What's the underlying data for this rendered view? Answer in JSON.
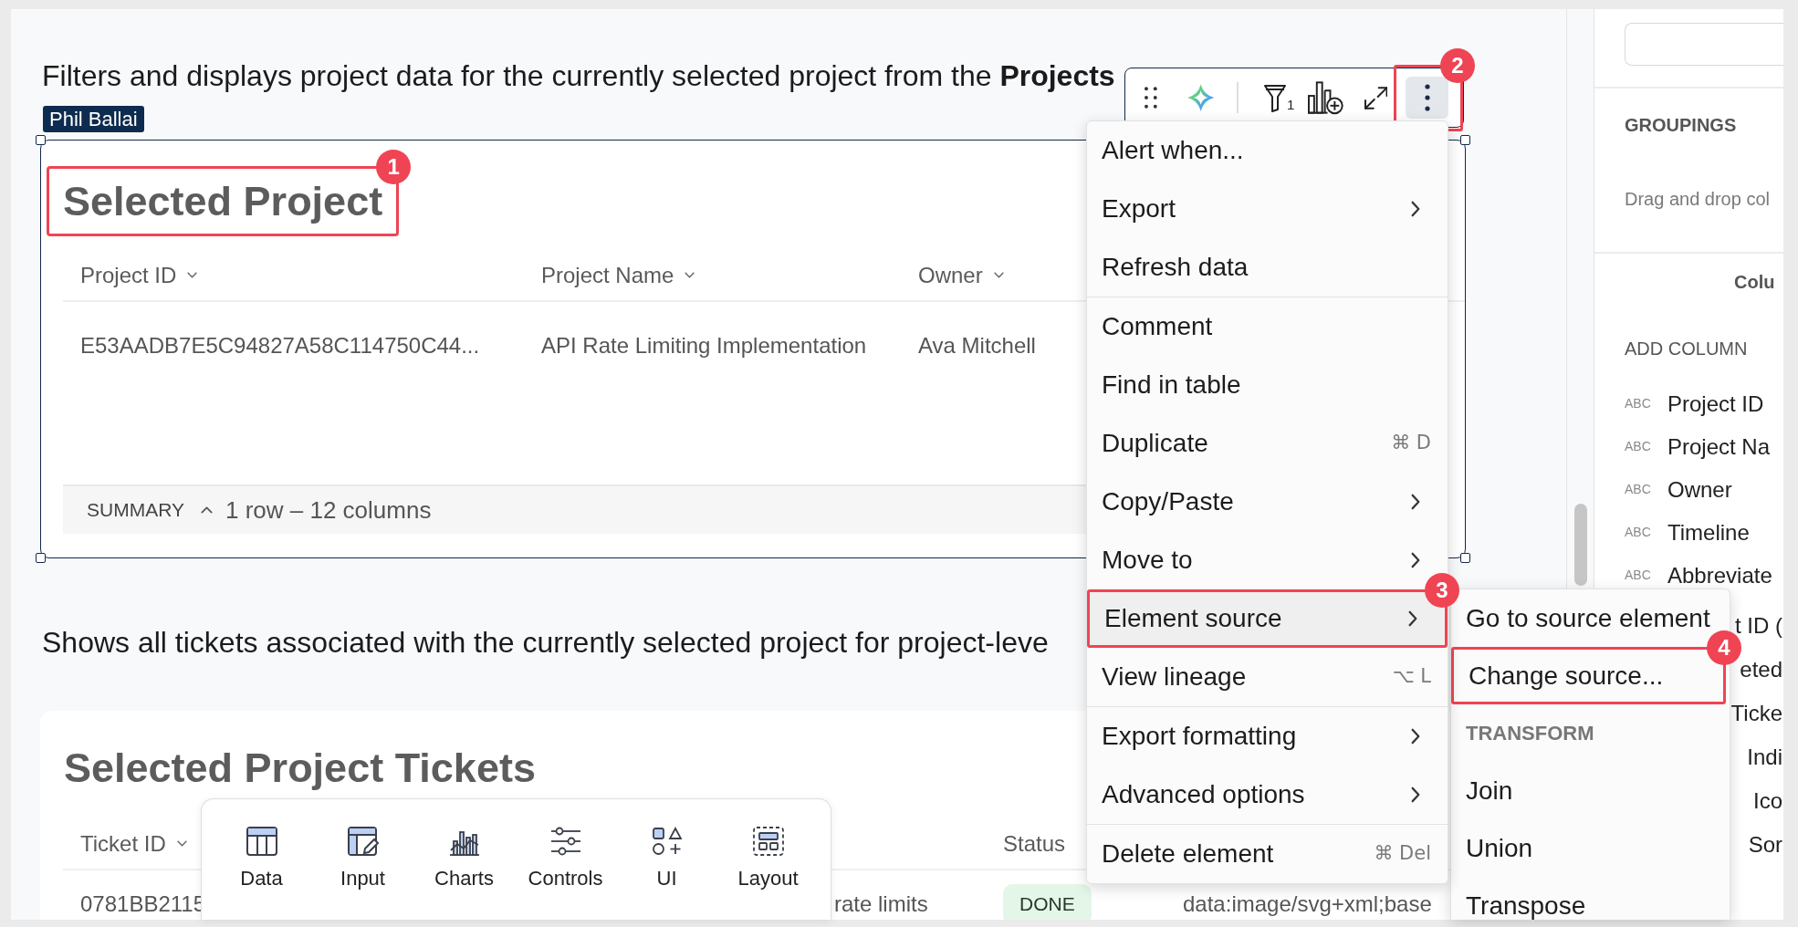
{
  "description_top": "Filters and displays project data for the currently selected project from the **Projects**",
  "selected_project": {
    "user_tag": "Phil Ballai",
    "title": "Selected Project",
    "callout": "1",
    "columns": [
      "Project ID",
      "Project Name",
      "Owner"
    ],
    "rows": [
      [
        "E53AADB7E5C94827A58C114750C44...",
        "API Rate Limiting Implementation",
        "Ava Mitchell"
      ]
    ],
    "summary": {
      "label": "SUMMARY",
      "count": "1 row – 12 columns"
    }
  },
  "description_bottom": "Shows all tickets associated with the currently selected project for project-leve",
  "tickets": {
    "title": "Selected Project Tickets",
    "header": {
      "ticket_id": "Ticket ID",
      "status": "Status"
    },
    "rows": [
      {
        "ticket_id": "0781BB2115",
        "column_2": "rate limits",
        "status": "DONE",
        "column_4": "data:image/svg+xml;base"
      }
    ]
  },
  "element_toolbar": {
    "filter_count": "1",
    "more_button": {
      "selected": true,
      "callout": "2"
    }
  },
  "context_menu": {
    "groups": [
      [
        {
          "label": "Alert when...",
          "submenu": false,
          "highlighted": false
        },
        {
          "label": "Export",
          "submenu": true,
          "highlighted": false
        },
        {
          "label": "Refresh data",
          "submenu": false,
          "highlighted": false
        }
      ],
      [
        {
          "label": "Comment",
          "submenu": false,
          "highlighted": false
        },
        {
          "label": "Find in table",
          "submenu": false,
          "highlighted": false
        },
        {
          "label": "Duplicate",
          "submenu": false,
          "highlighted": false,
          "shortcut": "⌘ D"
        },
        {
          "label": "Copy/Paste",
          "submenu": true,
          "highlighted": false
        },
        {
          "label": "Move to",
          "submenu": true,
          "highlighted": false
        },
        {
          "label": "Element source",
          "submenu": true,
          "highlighted": true,
          "callout": "3"
        },
        {
          "label": "View lineage",
          "submenu": false,
          "highlighted": false,
          "shortcut": "⌥ L"
        }
      ],
      [
        {
          "label": "Export formatting",
          "submenu": true,
          "highlighted": false
        },
        {
          "label": "Advanced options",
          "submenu": true,
          "highlighted": false
        }
      ],
      [
        {
          "label": "Delete element",
          "submenu": false,
          "highlighted": false,
          "shortcut": "⌘ Del"
        }
      ]
    ]
  },
  "submenu": {
    "items": [
      {
        "kind": "item",
        "label": "Go to source element",
        "highlighted": false
      },
      {
        "kind": "item",
        "label": "Change source...",
        "highlighted": false,
        "callout": "4"
      },
      {
        "kind": "heading",
        "label": "TRANSFORM"
      },
      {
        "kind": "item",
        "label": "Join",
        "highlighted": false
      },
      {
        "kind": "item",
        "label": "Union",
        "highlighted": false
      },
      {
        "kind": "item",
        "label": "Transpose",
        "highlighted": false
      }
    ]
  },
  "add_bar": {
    "items": [
      {
        "kind": "data",
        "label": "Data"
      },
      {
        "kind": "input",
        "label": "Input"
      },
      {
        "kind": "charts",
        "label": "Charts"
      },
      {
        "kind": "controls",
        "label": "Controls"
      },
      {
        "kind": "ui",
        "label": "UI"
      },
      {
        "kind": "layout",
        "label": "Layout"
      }
    ]
  },
  "right_panel": {
    "groupings_title": "GROUPINGS",
    "groupings_hint": "Drag and drop col",
    "columns_title": "Colu",
    "add_column_label": "ADD COLUMN",
    "columns": [
      {
        "kind": "visible",
        "type": "ABC",
        "name": "Project ID"
      },
      {
        "kind": "visible",
        "type": "ABC",
        "name": "Project Na"
      },
      {
        "kind": "visible",
        "type": "ABC",
        "name": "Owner"
      },
      {
        "kind": "visible",
        "type": "ABC",
        "name": "Timeline"
      },
      {
        "kind": "visible",
        "type": "ABC",
        "name": "Abbreviate"
      },
      {
        "kind": "covered",
        "name": "t ID ("
      },
      {
        "kind": "covered",
        "name": "eted"
      },
      {
        "kind": "covered",
        "name": "Ticke"
      },
      {
        "kind": "covered",
        "name": "Indi"
      },
      {
        "kind": "covered",
        "name": "Ico"
      },
      {
        "kind": "covered",
        "name": "Sor"
      }
    ]
  }
}
